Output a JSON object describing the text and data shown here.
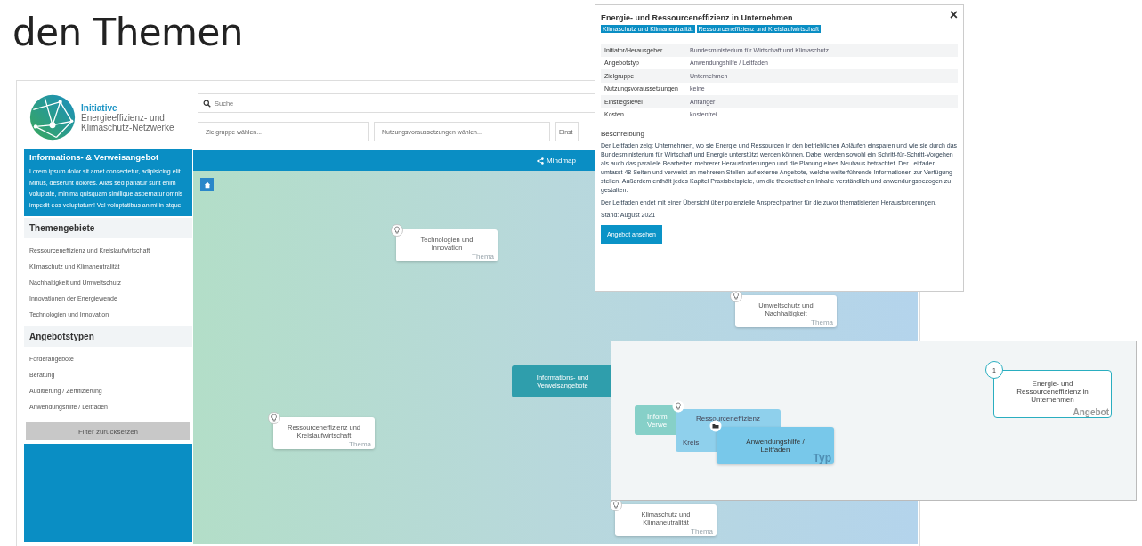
{
  "heading": "den Themen",
  "logo": {
    "title": "Initiative",
    "subtitle": [
      "Energieeffizienz- und",
      "Klimaschutz-Netzwerke"
    ]
  },
  "search": {
    "placeholder": "Suche"
  },
  "filters": [
    {
      "placeholder": "Zielgruppe wählen..."
    },
    {
      "placeholder": "Nutzungsvoraussetzungen wählen..."
    },
    {
      "placeholder": "Einst"
    }
  ],
  "info_box": {
    "title": "Informations- & Verweisangebot",
    "text": "Lorem ipsum dolor sit amet consectetur, adipisicing elit. Minus, deserunt dolores. Alias sed pariatur sunt enim voluptate, minima quisquam similique aspernatur omnis impedit eos voluptatum! Vel voluptatibus animi in atque."
  },
  "sections": [
    {
      "title": "Themengebiete",
      "items": [
        "Ressourceneffizienz und Kreislaufwirtschaft",
        "Klimaschutz und Klimaneutralität",
        "Nachhaltigkeit und Umweltschutz",
        "Innovationen der Energiewende",
        "Technologien und Innovation"
      ]
    },
    {
      "title": "Angebotstypen",
      "items": [
        "Förderangebote",
        "Beratung",
        "Auditierung / Zertifizierung",
        "Anwendungshilfe / Leitfaden"
      ]
    }
  ],
  "reset_button": "Filter zurücksetzen",
  "mindmap_tab": "Mindmap",
  "map_nodes": [
    {
      "kind": "topic",
      "label": "Technologien und Innovation",
      "tag": "Thema"
    },
    {
      "kind": "topic",
      "label": "Umweltschutz und Nachhaltigkeit",
      "tag": "Thema"
    },
    {
      "kind": "center",
      "label": "Informations- und Verweisangebote"
    },
    {
      "kind": "topic",
      "label": "Ressourceneffizienz und Kreislaufwirtschaft",
      "tag": "Thema"
    },
    {
      "kind": "topic",
      "label": "Klimaschutz und Klimaneutralität",
      "tag": "Thema"
    }
  ],
  "detail": {
    "title": "Energie- und Ressourceneffizienz in Unternehmen",
    "close": "×",
    "tags": [
      "Klimaschutz und Klimaneutralität",
      "Ressourceneffizienz und Kreislaufwirtschaft"
    ],
    "rows": [
      {
        "label": "Initiator/Herausgeber",
        "value": "Bundesministerium für Wirtschaft und Klimaschutz"
      },
      {
        "label": "Angebotstyp",
        "value": "Anwendungshilfe / Leitfaden"
      },
      {
        "label": "Zielgruppe",
        "value": "Unternehmen"
      },
      {
        "label": "Nutzungsvoraussetzungen",
        "value": "keine"
      },
      {
        "label": "Einstiegslevel",
        "value": "Anfänger"
      },
      {
        "label": "Kosten",
        "value": "kostenfrei"
      }
    ],
    "description_title": "Beschreibung",
    "paragraphs": [
      "Der Leitfaden zeigt Unternehmen, wo sie Energie und Ressourcen in den betrieblichen Abläufen einsparen und wie sie durch das Bundesministerium für Wirtschaft und Energie unterstützt werden können. Dabei werden sowohl ein Schritt-für-Schritt-Vorgehen als auch das parallele Bearbeiten mehrerer Herausforderungen und die Planung eines Neubaus betrachtet. Der Leitfaden umfasst 48 Seiten und verweist an mehreren Stellen auf externe Angebote, welche weiterführende Informationen zur Verfügung stellen. Außerdem enthält jedes Kapitel Praxisbeispiele, um die theoretischen Inhalte verständlich und anwendungsbezogen zu gestalten.",
      "Der Leitfaden endet mit einer Übersicht über potenzielle Ansprechpartner für die zuvor thematisierten Herausforderungen.",
      "Stand: August 2021"
    ],
    "button": "Angebot ansehen"
  },
  "zoom_panel": {
    "cards": [
      {
        "kind": "faded",
        "lines": [
          "Inform",
          "Verwe"
        ]
      },
      {
        "kind": "light",
        "lines": [
          "Ressourceneffizienz",
          "Kreis"
        ]
      },
      {
        "kind": "type",
        "lines": [
          "Anwendungshilfe /",
          "Leitfaden"
        ],
        "tag": "Typ"
      }
    ],
    "offer": {
      "badge": "1",
      "label": "Energie- und Ressourceneffizienz in Unternehmen",
      "tag": "Angebot"
    }
  }
}
